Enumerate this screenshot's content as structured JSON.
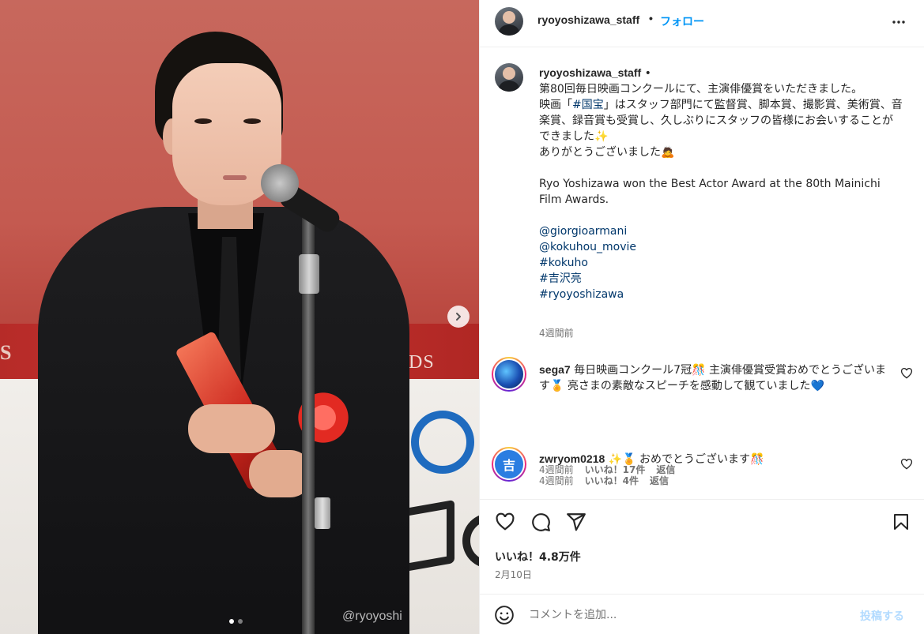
{
  "photo": {
    "banner_left_text": "S",
    "banner_right_text": "RDS",
    "watermark": "@ryoyoshi",
    "carousel_dots": 2,
    "active_dot": 0
  },
  "post": {
    "username": "ryoyoshizawa_staff",
    "separator": "•",
    "follow_label": "フォロー"
  },
  "caption": {
    "username": "ryoyoshizawa_staff",
    "dot": " •",
    "line1": "第80回毎日映画コンクールにて、主演俳優賞をいただきました。",
    "line2_pre": "映画「",
    "line2_tag": "#国宝",
    "line2_post": "」はスタッフ部門にて監督賞、脚本賞、撮影賞、美術賞、音楽賞、録音賞も受賞し、久しぶりにスタッフの皆様にお会いすることができました✨",
    "line3": "ありがとうございました🙇",
    "english": "Ryo Yoshizawa won the Best Actor Award at the 80th Mainichi Film Awards.",
    "tags": [
      "@giorgioarmani",
      "@kokuhou_movie",
      "#kokuho",
      "#吉沢亮",
      "#ryoyoshizawa"
    ],
    "time": "4週間前"
  },
  "comments": [
    {
      "username": "sega7",
      "text": "毎日映画コンクール7冠🎊 主演俳優賞受賞おめでとうございます🏅 亮さまの素敵なスピーチを感動して観ていました💙",
      "time": "4週間前",
      "likes": "いいね！17件",
      "reply": "返信"
    },
    {
      "username": "zwryom0218",
      "avatar_text": "吉",
      "text": "✨🏅 おめでとうございます🎊",
      "time": "4週間前",
      "likes": "いいね！4件",
      "reply": "返信"
    }
  ],
  "actions": {
    "likes": "いいね！4.8万件",
    "date": "2月10日"
  },
  "comment_box": {
    "placeholder": "コメントを追加...",
    "post_label": "投稿する"
  },
  "colors": {
    "accent": "#0095f6",
    "link": "#00376b",
    "muted": "#737373",
    "post_disabled": "#b3dbff"
  }
}
